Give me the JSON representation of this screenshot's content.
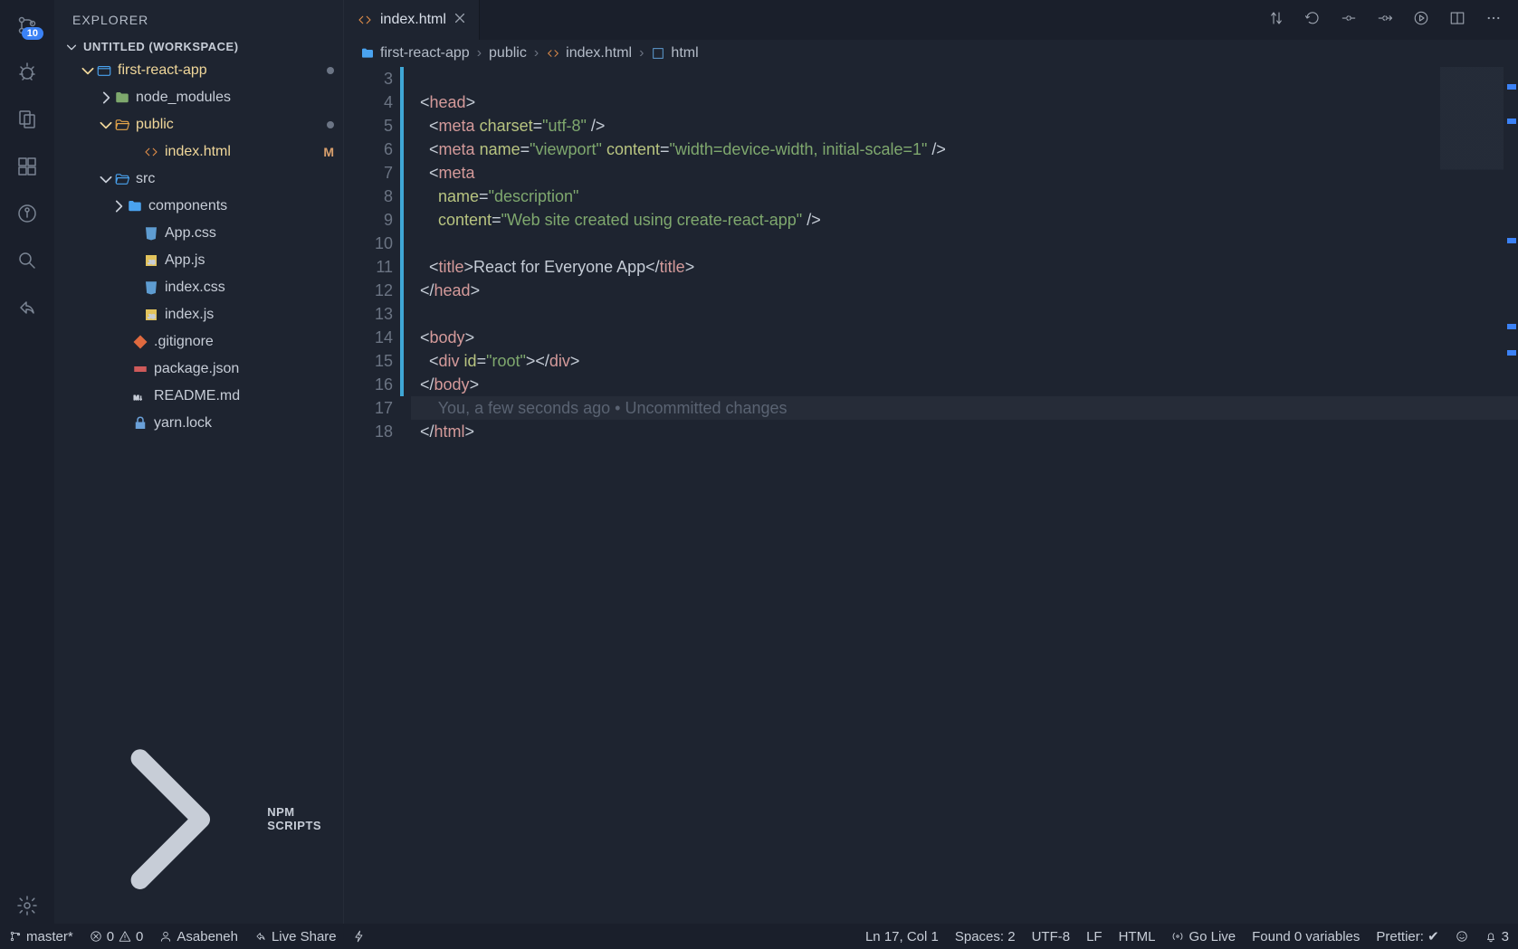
{
  "sidebar": {
    "title": "EXPLORER",
    "workspace_header": "UNTITLED (WORKSPACE)",
    "scm_badge": "10",
    "tree": {
      "root": "first-react-app",
      "nodes": [
        {
          "pad": 28,
          "twisty": "down",
          "icon": "folder-root",
          "label": "first-react-app",
          "dot": true,
          "active": true
        },
        {
          "pad": 48,
          "twisty": "right",
          "icon": "folder-mod",
          "label": "node_modules"
        },
        {
          "pad": 48,
          "twisty": "down",
          "icon": "folder-open-a",
          "label": "public",
          "dot": true,
          "active": true
        },
        {
          "pad": 80,
          "icon": "file-html",
          "label": "index.html",
          "mod": "M",
          "active": true
        },
        {
          "pad": 48,
          "twisty": "down",
          "icon": "folder-open",
          "label": "src"
        },
        {
          "pad": 62,
          "twisty": "right",
          "icon": "folder",
          "label": "components"
        },
        {
          "pad": 80,
          "icon": "file-css",
          "label": "App.css"
        },
        {
          "pad": 80,
          "icon": "file-js",
          "label": "App.js"
        },
        {
          "pad": 80,
          "icon": "file-css",
          "label": "index.css"
        },
        {
          "pad": 80,
          "icon": "file-js",
          "label": "index.js"
        },
        {
          "pad": 68,
          "icon": "file-git",
          "label": ".gitignore"
        },
        {
          "pad": 68,
          "icon": "file-npm",
          "label": "package.json"
        },
        {
          "pad": 68,
          "icon": "file-md",
          "label": "README.md"
        },
        {
          "pad": 68,
          "icon": "file-lock",
          "label": "yarn.lock"
        }
      ]
    },
    "bottom_section": "NPM SCRIPTS"
  },
  "tab": {
    "label": "index.html"
  },
  "breadcrumbs": {
    "segments": [
      "first-react-app",
      "public",
      "index.html",
      "html"
    ]
  },
  "code": {
    "first_line_no": 3,
    "lines": [
      {
        "n": 3,
        "mod": true,
        "raw": ""
      },
      {
        "n": 4,
        "mod": true,
        "tokens": [
          [
            "t-punc",
            "  <"
          ],
          [
            "t-tag",
            "head"
          ],
          [
            "t-punc",
            ">"
          ]
        ]
      },
      {
        "n": 5,
        "mod": true,
        "tokens": [
          [
            "t-punc",
            "    <"
          ],
          [
            "t-tag",
            "meta"
          ],
          [
            "t-punc",
            " "
          ],
          [
            "t-attr",
            "charset"
          ],
          [
            "t-punc",
            "="
          ],
          [
            "t-str",
            "\"utf-8\""
          ],
          [
            "t-punc",
            " />"
          ]
        ]
      },
      {
        "n": 6,
        "mod": true,
        "tokens": [
          [
            "t-punc",
            "    <"
          ],
          [
            "t-tag",
            "meta"
          ],
          [
            "t-punc",
            " "
          ],
          [
            "t-attr",
            "name"
          ],
          [
            "t-punc",
            "="
          ],
          [
            "t-str",
            "\"viewport\""
          ],
          [
            "t-punc",
            " "
          ],
          [
            "t-attr",
            "content"
          ],
          [
            "t-punc",
            "="
          ],
          [
            "t-str",
            "\"width=device-width, initial-scale=1\""
          ],
          [
            "t-punc",
            " />"
          ]
        ]
      },
      {
        "n": 7,
        "mod": true,
        "tokens": [
          [
            "t-punc",
            "    <"
          ],
          [
            "t-tag",
            "meta"
          ]
        ]
      },
      {
        "n": 8,
        "mod": true,
        "tokens": [
          [
            "t-punc",
            "      "
          ],
          [
            "t-attr",
            "name"
          ],
          [
            "t-punc",
            "="
          ],
          [
            "t-str",
            "\"description\""
          ]
        ]
      },
      {
        "n": 9,
        "mod": true,
        "tokens": [
          [
            "t-punc",
            "      "
          ],
          [
            "t-attr",
            "content"
          ],
          [
            "t-punc",
            "="
          ],
          [
            "t-str",
            "\"Web site created using create-react-app\""
          ],
          [
            "t-punc",
            " />"
          ]
        ]
      },
      {
        "n": 10,
        "mod": true,
        "raw": ""
      },
      {
        "n": 11,
        "mod": true,
        "tokens": [
          [
            "t-punc",
            "    <"
          ],
          [
            "t-tag",
            "title"
          ],
          [
            "t-punc",
            ">"
          ],
          [
            "t-text",
            "React for Everyone App"
          ],
          [
            "t-punc",
            "</"
          ],
          [
            "t-tag",
            "title"
          ],
          [
            "t-punc",
            ">"
          ]
        ]
      },
      {
        "n": 12,
        "mod": true,
        "tokens": [
          [
            "t-punc",
            "  </"
          ],
          [
            "t-tag",
            "head"
          ],
          [
            "t-punc",
            ">"
          ]
        ]
      },
      {
        "n": 13,
        "mod": true,
        "raw": ""
      },
      {
        "n": 14,
        "mod": true,
        "tokens": [
          [
            "t-punc",
            "  <"
          ],
          [
            "t-tag",
            "body"
          ],
          [
            "t-punc",
            ">"
          ]
        ]
      },
      {
        "n": 15,
        "mod": true,
        "tokens": [
          [
            "t-punc",
            "    <"
          ],
          [
            "t-tag",
            "div"
          ],
          [
            "t-punc",
            " "
          ],
          [
            "t-attr",
            "id"
          ],
          [
            "t-punc",
            "="
          ],
          [
            "t-str",
            "\"root\""
          ],
          [
            "t-punc",
            "></"
          ],
          [
            "t-tag",
            "div"
          ],
          [
            "t-punc",
            ">"
          ]
        ]
      },
      {
        "n": 16,
        "mod": true,
        "tokens": [
          [
            "t-punc",
            "  </"
          ],
          [
            "t-tag",
            "body"
          ],
          [
            "t-punc",
            ">"
          ]
        ]
      },
      {
        "n": 17,
        "mod": false,
        "current": true,
        "tokens": [
          [
            "t-punc",
            "  "
          ]
        ],
        "codelens": "    You, a few seconds ago • Uncommitted changes"
      },
      {
        "n": 18,
        "mod": false,
        "tokens": [
          [
            "t-punc",
            "  </"
          ],
          [
            "t-tag",
            "html"
          ],
          [
            "t-punc",
            ">"
          ]
        ]
      }
    ]
  },
  "status": {
    "branch": "master*",
    "errors": "0",
    "warnings": "0",
    "user": "Asabeneh",
    "live_share": "Live Share",
    "ln_col": "Ln 17, Col 1",
    "spaces": "Spaces: 2",
    "encoding": "UTF-8",
    "eol": "LF",
    "lang": "HTML",
    "go_live": "Go Live",
    "found_vars": "Found 0 variables",
    "prettier": "Prettier: ✔",
    "notifications": "3"
  }
}
